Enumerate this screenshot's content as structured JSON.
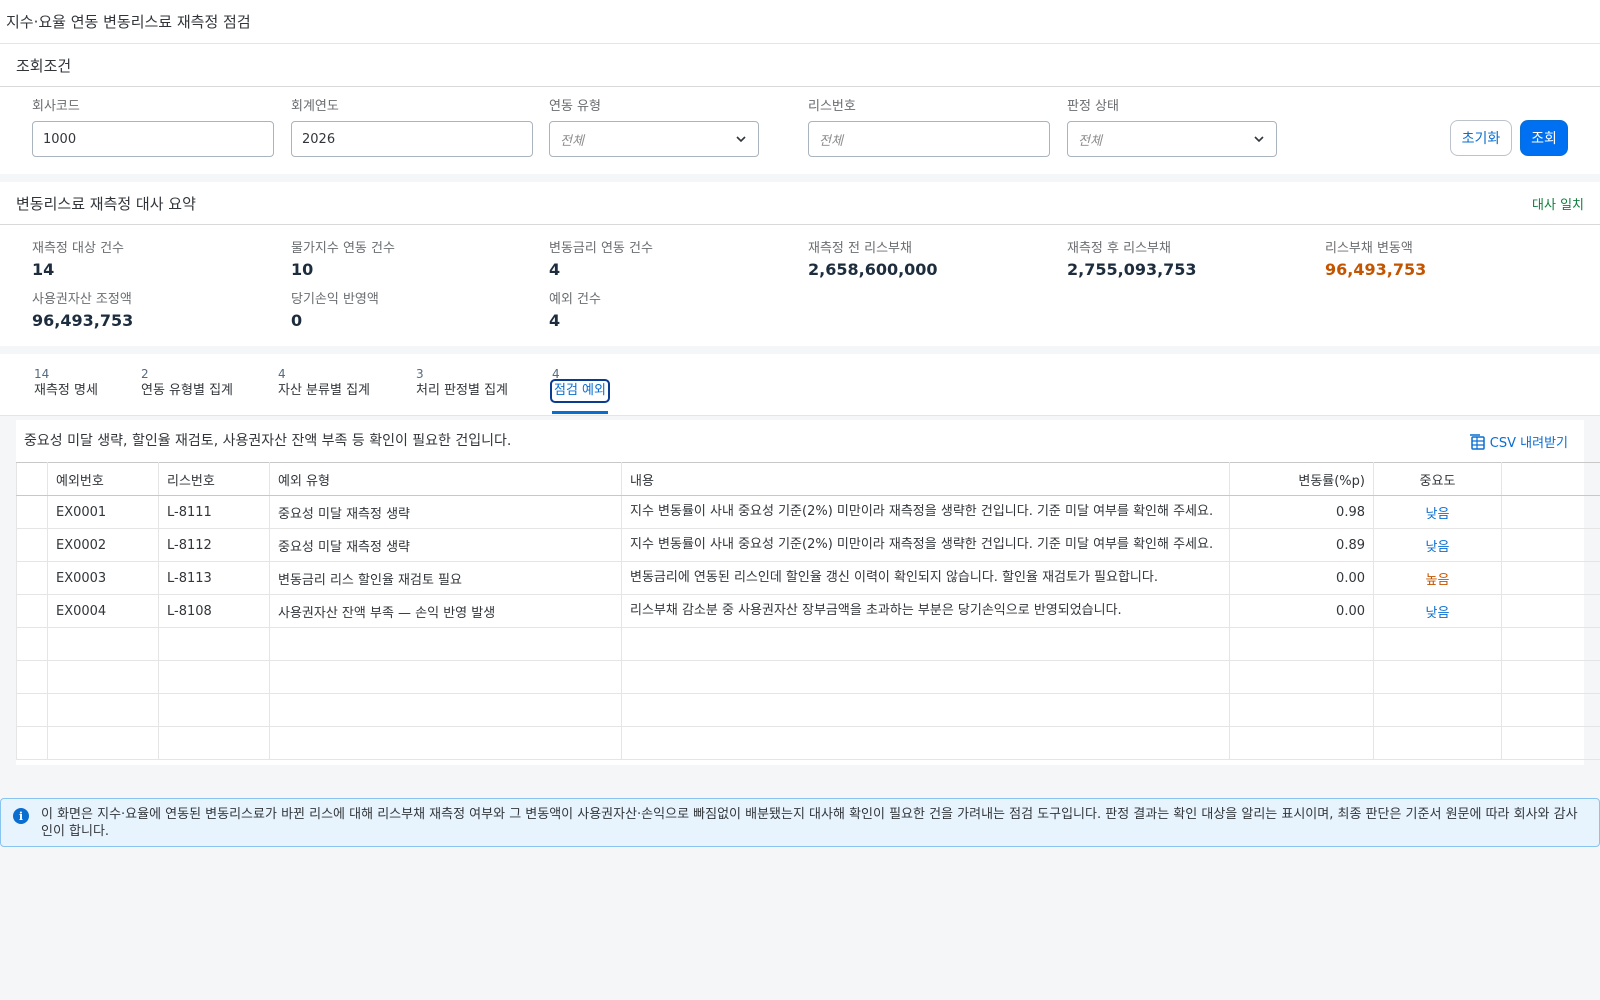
{
  "app": {
    "title": "지수·요율 연동 변동리스료 재측정 점검"
  },
  "filter": {
    "title": "조회조건",
    "company_label": "회사코드",
    "company_value": "1000",
    "year_label": "회계연도",
    "year_value": "2026",
    "link_type_label": "연동 유형",
    "link_type_value": "전체",
    "lease_no_label": "리스번호",
    "lease_no_placeholder": "전체",
    "status_label": "판정 상태",
    "status_value": "전체",
    "reset_label": "초기화",
    "search_label": "조회"
  },
  "summary": {
    "title": "변동리스료 재측정 대사 요약",
    "status": "대사 일치",
    "kpis": [
      {
        "label": "재측정 대상 건수",
        "value": "14"
      },
      {
        "label": "물가지수 연동 건수",
        "value": "10"
      },
      {
        "label": "변동금리 연동 건수",
        "value": "4"
      },
      {
        "label": "재측정 전 리스부채",
        "value": "2,658,600,000"
      },
      {
        "label": "재측정 후 리스부채",
        "value": "2,755,093,753"
      },
      {
        "label": "리스부채 변동액",
        "value": "96,493,753"
      },
      {
        "label": "사용권자산 조정액",
        "value": "96,493,753"
      },
      {
        "label": "당기손익 반영액",
        "value": "0"
      },
      {
        "label": "예외 건수",
        "value": "4"
      }
    ]
  },
  "tabs": [
    {
      "count": "14",
      "label": "재측정 명세"
    },
    {
      "count": "2",
      "label": "연동 유형별 집계"
    },
    {
      "count": "4",
      "label": "자산 분류별 집계"
    },
    {
      "count": "3",
      "label": "처리 판정별 집계"
    },
    {
      "count": "4",
      "label": "점검 예외"
    }
  ],
  "exceptions": {
    "note": "중요성 미달 생략, 할인율 재검토, 사용권자산 잔액 부족 등 확인이 필요한 건입니다.",
    "csv_label": "CSV 내려받기",
    "columns": {
      "id": "예외번호",
      "lease": "리스번호",
      "type": "예외 유형",
      "content": "내용",
      "rate": "변동률(%p)",
      "severity": "중요도"
    },
    "rows": [
      {
        "id": "EX0001",
        "lease": "L-8111",
        "type": "중요성 미달 재측정 생략",
        "content": "지수 변동률이 사내 중요성 기준(2%) 미만이라 재측정을 생략한 건입니다. 기준 미달 여부를 확인해 주세요.",
        "rate": "0.98",
        "severity": "낮음"
      },
      {
        "id": "EX0002",
        "lease": "L-8112",
        "type": "중요성 미달 재측정 생략",
        "content": "지수 변동률이 사내 중요성 기준(2%) 미만이라 재측정을 생략한 건입니다. 기준 미달 여부를 확인해 주세요.",
        "rate": "0.89",
        "severity": "낮음"
      },
      {
        "id": "EX0003",
        "lease": "L-8113",
        "type": "변동금리 리스 할인율 재검토 필요",
        "content": "변동금리에 연동된 리스인데 할인율 갱신 이력이 확인되지 않습니다. 할인율 재검토가 필요합니다.",
        "rate": "0.00",
        "severity": "높음"
      },
      {
        "id": "EX0004",
        "lease": "L-8108",
        "type": "사용권자산 잔액 부족 — 손익 반영 발생",
        "content": "리스부채 감소분 중 사용권자산 장부금액을 초과하는 부분은 당기손익으로 반영되었습니다.",
        "rate": "0.00",
        "severity": "낮음"
      }
    ]
  },
  "info": {
    "icon": "info-icon",
    "text": "이 화면은 지수·요율에 연동된 변동리스료가 바뀐 리스에 대해 리스부채 재측정 여부와 그 변동액이 사용권자산·손익으로 빠짐없이 배분됐는지 대사해 확인이 필요한 건을 가려내는 점검 도구입니다. 판정 결과는 확인 대상을 알리는 표시이며, 최종 판단은 기준서 원문에 따라 회사와 감사인이 합니다."
  },
  "colors": {
    "accent": "#0a6ed1",
    "primary_button": "#0070f2",
    "warning": "#c35500",
    "success": "#107e3e",
    "info_bg": "#e8f4fd"
  }
}
